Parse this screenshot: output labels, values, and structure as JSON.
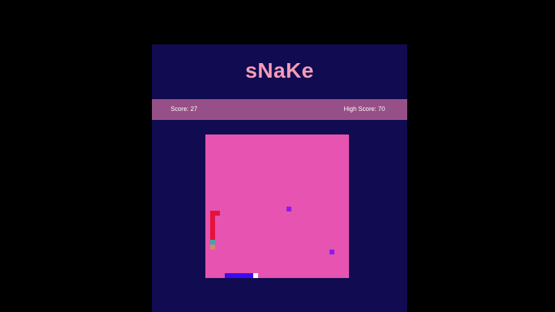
{
  "game": {
    "title": "sNaKe",
    "score_label": "Score: 27",
    "high_score_label": "High Score: 70",
    "score": 27,
    "high_score": 70
  },
  "board": {
    "grid_size": 30,
    "background_color": "#e653b0",
    "food": [
      {
        "col": 17,
        "row": 15,
        "color": "#8a1ee8"
      },
      {
        "col": 26,
        "row": 24,
        "color": "#8a1ee8"
      }
    ],
    "red_snake": {
      "color": "#e5123c",
      "segments": [
        [
          2,
          16
        ],
        [
          1,
          16
        ],
        [
          1,
          17
        ],
        [
          1,
          18
        ],
        [
          1,
          19
        ],
        [
          1,
          20
        ],
        [
          1,
          21
        ]
      ]
    },
    "red_snake_tail": [
      {
        "col": 1,
        "row": 22,
        "color": "#49a4a5"
      },
      {
        "col": 1,
        "row": 23,
        "color": "#d8866e"
      }
    ],
    "blue_snake": {
      "color": "#3a0cf2",
      "segments": [
        [
          4,
          29
        ],
        [
          5,
          29
        ],
        [
          6,
          29
        ],
        [
          7,
          29
        ],
        [
          8,
          29
        ],
        [
          9,
          29
        ]
      ],
      "head": {
        "col": 10,
        "row": 29,
        "color": "#ffffff"
      }
    }
  },
  "colors": {
    "page_background": "#000000",
    "panel_background": "#110b51",
    "title_color": "#f49bb8",
    "score_bar": "#974f87"
  }
}
